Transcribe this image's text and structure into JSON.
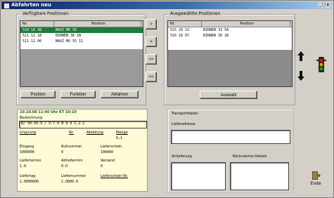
{
  "window": {
    "title": "Abfahrten neu",
    "controls": "_ □ x"
  },
  "left_group": {
    "legend": "Verfügbare Positionen",
    "columns": [
      "Nr.",
      "Position"
    ],
    "rows": [
      {
        "nr": "510 1A 98",
        "pos": "MAXI MO 55"
      },
      {
        "nr": "511 12 18",
        "pos": "BIRNEN 36 1B"
      },
      {
        "nr": "511 12 06",
        "pos": "MAXI MO 55 11"
      }
    ],
    "buttons": [
      "Position",
      "Funktion",
      "Abfahren"
    ]
  },
  "transfer_buttons": [
    ">",
    "<",
    ">>",
    "<<"
  ],
  "right_group": {
    "legend": "Ausgewählte Positionen",
    "columns": [
      "Nr.",
      "Position"
    ],
    "rows": [
      {
        "nr": "515 10 11",
        "pos": "BIRNEN 33 5A"
      },
      {
        "nr": "516 10 07",
        "pos": "BIRNEN 36 1B"
      }
    ],
    "button": "Auswahl"
  },
  "detail": {
    "header": "10.10.98  11:40 Uhr   KT 10:10",
    "field1_label": "Bezeichnung",
    "field1_value": "B/ 99.99.9 / V.T.9 B 9 9 1.2.1",
    "labels_row2": [
      "Ursprung",
      "Nr.",
      "Abteilung",
      "Menge"
    ],
    "values_row2": [
      "",
      "",
      "",
      "0,1"
    ],
    "labels_row3": [
      "Eingang",
      "Rufnummer",
      "Lieferschein"
    ],
    "values_row3": [
      "1000000",
      "0",
      "100000"
    ],
    "labels_row4": [
      "Liefertermin",
      "Abholtermin",
      "Versand"
    ],
    "values_row4": [
      "1.0",
      "0.0",
      "0"
    ],
    "labels_row5": [
      "Liefertag",
      "Liefernummer",
      "Lieferschein-Nr."
    ],
    "values_row5": [
      "1.0000000",
      "1.0000.0",
      ""
    ]
  },
  "transport": {
    "title": "Transportdaten",
    "field_label": "Lieferadresse",
    "sub_labels": [
      "Anlieferung",
      "Rücknahme-Details"
    ]
  },
  "icons": {
    "up": "arrow-up-icon",
    "down": "arrow-down-icon",
    "traffic": "traffic-light-icon",
    "exit": "exit-icon"
  },
  "exit_label": "Ende"
}
